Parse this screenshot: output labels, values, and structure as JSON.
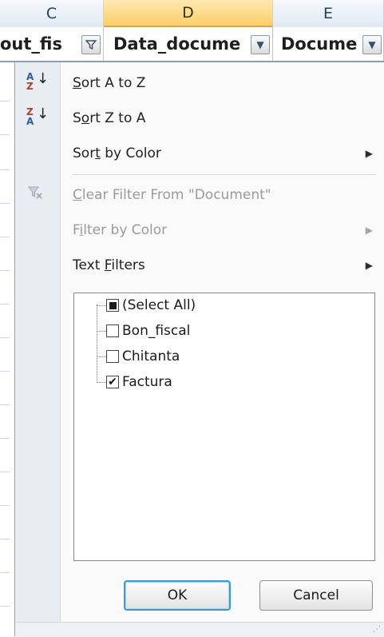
{
  "columns": {
    "c": "C",
    "d": "D",
    "e": "E"
  },
  "fields": {
    "c": "out_fis",
    "d": "Data_docume",
    "e": "Docume"
  },
  "menu": {
    "sort_az_pre": "",
    "sort_az_u": "S",
    "sort_az_post": "ort A to Z",
    "sort_za_pre": "S",
    "sort_za_u": "o",
    "sort_za_post": "rt Z to A",
    "sort_color_pre": "Sor",
    "sort_color_u": "t",
    "sort_color_post": " by Color",
    "clear_pre": "",
    "clear_u": "C",
    "clear_post": "lear Filter From \"Document\"",
    "filter_color_pre": "F",
    "filter_color_u": "i",
    "filter_color_post": "lter by Color",
    "text_filters_pre": "Text ",
    "text_filters_u": "F",
    "text_filters_post": "ilters"
  },
  "list": [
    {
      "label": "(Select All)",
      "state": "partial"
    },
    {
      "label": "Bon_fiscal",
      "state": "unchecked"
    },
    {
      "label": "Chitanta",
      "state": "unchecked"
    },
    {
      "label": "Factura",
      "state": "checked"
    }
  ],
  "buttons": {
    "ok": "OK",
    "cancel": "Cancel"
  },
  "colors": {
    "selected_column": "#fbcf68",
    "ok_border": "#3b9ad9"
  }
}
